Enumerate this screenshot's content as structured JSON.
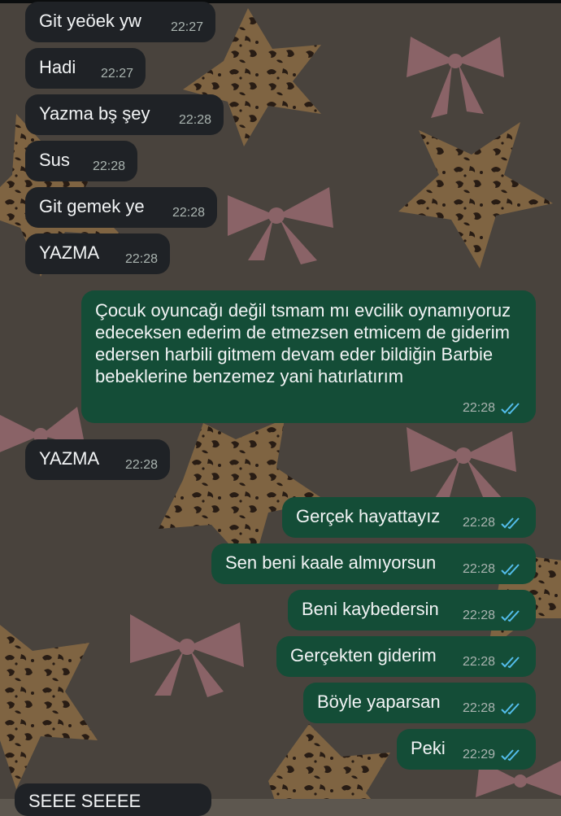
{
  "messages": [
    {
      "dir": "in",
      "text": "Git yeöek yw",
      "time": "22:27"
    },
    {
      "dir": "in",
      "text": "Hadi",
      "time": "22:27"
    },
    {
      "dir": "in",
      "text": "Yazma bş şey",
      "time": "22:28"
    },
    {
      "dir": "in",
      "text": "Sus",
      "time": "22:28"
    },
    {
      "dir": "in",
      "text": "Git gemek ye",
      "time": "22:28"
    },
    {
      "dir": "in",
      "text": "YAZMA",
      "time": "22:28"
    },
    {
      "dir": "out",
      "text": "Çocuk oyuncağı değil tsmam mı evcilik oynamıyoruz edeceksen ederim de etmezsen etmicem de giderim edersen harbili gitmem devam eder bildiğin Barbie bebeklerine benzemez yani hatırlatırım",
      "time": "22:28",
      "status": "read"
    },
    {
      "dir": "in",
      "text": "YAZMA",
      "time": "22:28"
    },
    {
      "dir": "out",
      "text": "Gerçek hayattayız",
      "time": "22:28",
      "status": "read"
    },
    {
      "dir": "out",
      "text": "Sen beni kaale almıyorsun",
      "time": "22:28",
      "status": "read"
    },
    {
      "dir": "out",
      "text": "Beni kaybedersin",
      "time": "22:28",
      "status": "read"
    },
    {
      "dir": "out",
      "text": "Gerçekten giderim",
      "time": "22:28",
      "status": "read"
    },
    {
      "dir": "out",
      "text": "Böyle yaparsan",
      "time": "22:28",
      "status": "read"
    },
    {
      "dir": "out",
      "text": "Peki",
      "time": "22:29",
      "status": "read"
    }
  ],
  "partial_message": {
    "dir": "in",
    "text": "SEEE SEEEE"
  },
  "icons": {
    "read_receipt": "double-check-icon",
    "wallpaper": "leopard-star-and-pink-bow-pattern"
  },
  "colors": {
    "incoming_bubble": "#1f2226",
    "outgoing_bubble": "#144d37",
    "read_tick": "#53bdeb",
    "timestamp": "#aab4b0",
    "text": "#f2f4f5"
  }
}
